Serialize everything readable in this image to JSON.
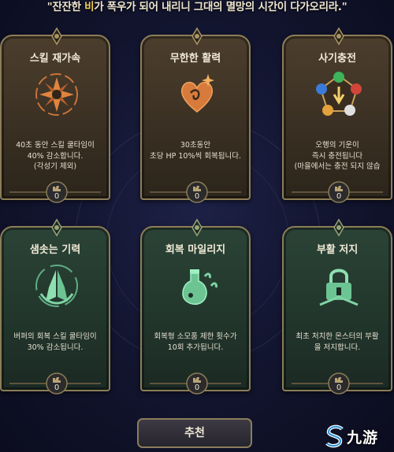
{
  "banner": {
    "prefix": "\"잔잔한 ",
    "highlight": "비",
    "suffix": "가 폭우가 되어 내리니 그대의 멸망의 시간이 다가오리라.\""
  },
  "cards": [
    {
      "title": "스킬 재가속",
      "desc": "40초 동안 스킬 쿨타임이\n40% 감소합니다.\n(각성기 제외)",
      "count": "0",
      "icon": "spinning-shuriken-icon",
      "theme": "brown"
    },
    {
      "title": "무한한 활력",
      "desc": "30초동안\n초당 HP 10%씩 회복됩니다.",
      "count": "0",
      "icon": "sparkling-heart-icon",
      "theme": "brown"
    },
    {
      "title": "사기충전",
      "desc": "오행의 기운이\n즉시 충전됩니다\n(마을에서는 충전 되지 않습",
      "count": "0",
      "icon": "five-elements-pentagon-icon",
      "theme": "brown"
    },
    {
      "title": "샘솟는 기력",
      "desc": "버퍼의 회복 스킬 쿨타임이\n30% 감소됩니다.",
      "count": "0",
      "icon": "praying-hands-icon",
      "theme": "green"
    },
    {
      "title": "회복 마일리지",
      "desc": "회복형 소모품 제한 횟수가\n10회 추가됩니다.",
      "count": "0",
      "icon": "potion-flask-icon",
      "theme": "green"
    },
    {
      "title": "부활 저지",
      "desc": "최초 처치한 몬스터의 부활\n을 저지합니다.",
      "count": "0",
      "icon": "padlock-icon",
      "theme": "green"
    }
  ],
  "recommend_label": "추천",
  "watermark": {
    "text": "九游",
    "icon": "s-logo-icon"
  },
  "colors": {
    "accent_gold": "#f3cf55",
    "card_border": "#8c7d58",
    "brown_card": "#3a3023",
    "green_card": "#22362c",
    "emblem_orange": "#d87a3a",
    "emblem_green": "#7fd4a4"
  }
}
